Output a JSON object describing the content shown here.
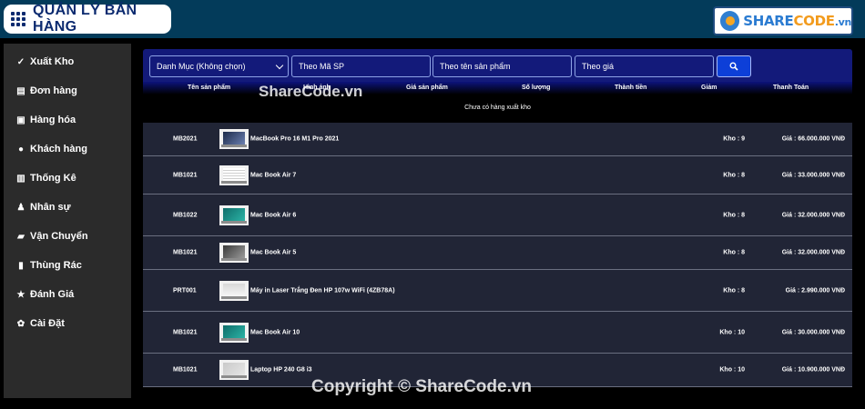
{
  "header": {
    "title": "QUẢN LÝ BÁN HÀNG"
  },
  "logo": {
    "text_main": "SHARE",
    "text_hl": "CODE",
    "text_tld": ".vn"
  },
  "sidebar": {
    "items": [
      {
        "icon": "check-icon",
        "glyph": "✓",
        "label": "Xuất Kho"
      },
      {
        "icon": "document-icon",
        "glyph": "▤",
        "label": "Đơn hàng"
      },
      {
        "icon": "archive-icon",
        "glyph": "▣",
        "label": "Hàng hóa"
      },
      {
        "icon": "user-icon",
        "glyph": "●",
        "label": "Khách hàng"
      },
      {
        "icon": "chart-icon",
        "glyph": "▥",
        "label": "Thống Kê"
      },
      {
        "icon": "users-icon",
        "glyph": "♟",
        "label": "Nhân sự"
      },
      {
        "icon": "truck-icon",
        "glyph": "▰",
        "label": "Vận Chuyển"
      },
      {
        "icon": "trash-icon",
        "glyph": "▮",
        "label": "Thùng Rác"
      },
      {
        "icon": "star-icon",
        "glyph": "★",
        "label": "Đánh Giá"
      },
      {
        "icon": "gear-icon",
        "glyph": "✿",
        "label": "Cài Đặt"
      }
    ]
  },
  "filters": {
    "category": "Danh Mục (Không chọn)",
    "by_code": "Theo Mã SP",
    "by_name": "Theo tên sản phẩm",
    "by_price": "Theo giá"
  },
  "columns": {
    "name": "Tên sản phẩm",
    "image": "Hình ảnh",
    "price": "Giá sản phẩm",
    "qty": "Số lượng",
    "total": "Thành tiền",
    "discount": "Giảm",
    "pay": "Thanh Toán"
  },
  "empty_message": "Chưa có hàng xuất kho",
  "products": [
    {
      "code": "MB2021",
      "name": "MacBook Pro 16 M1 Pro 2021",
      "stock": "Kho : 9",
      "price": "Giá : 66.000.000 VNĐ",
      "thumb": "macbook-dark"
    },
    {
      "code": "MB1021",
      "name": "Mac Book Air 7",
      "stock": "Kho : 8",
      "price": "Giá : 33.000.000 VNĐ",
      "thumb": "spreadsheet"
    },
    {
      "code": "MB1022",
      "name": "Mac Book Air 6",
      "stock": "Kho : 8",
      "price": "Giá : 32.000.000 VNĐ",
      "thumb": "laptop-teal"
    },
    {
      "code": "MB1021",
      "name": "Mac Book Air 5",
      "stock": "Kho : 8",
      "price": "Giá : 32.000.000 VNĐ",
      "thumb": "laptop-open"
    },
    {
      "code": "PRT001",
      "name": "Máy in Laser Trắng Đen HP 107w WiFi (4ZB78A)",
      "stock": "Kho : 8",
      "price": "Giá : 2.990.000 VNĐ",
      "thumb": "printer"
    },
    {
      "code": "MB1021",
      "name": "Mac Book Air 10",
      "stock": "Kho : 10",
      "price": "Giá : 30.000.000 VNĐ",
      "thumb": "laptop-teal"
    },
    {
      "code": "MB1021",
      "name": "Laptop HP 240 G8 i3",
      "stock": "Kho : 10",
      "price": "Giá : 10.900.000 VNĐ",
      "thumb": "laptop-silver"
    }
  ],
  "watermarks": {
    "top": "ShareCode.vn",
    "bottom": "Copyright © ShareCode.vn"
  },
  "colors": {
    "header_bg": "#033b5a",
    "filter_bg": "#131a7a",
    "row_bg": "#212536",
    "search_btn": "#0d3fd8"
  }
}
